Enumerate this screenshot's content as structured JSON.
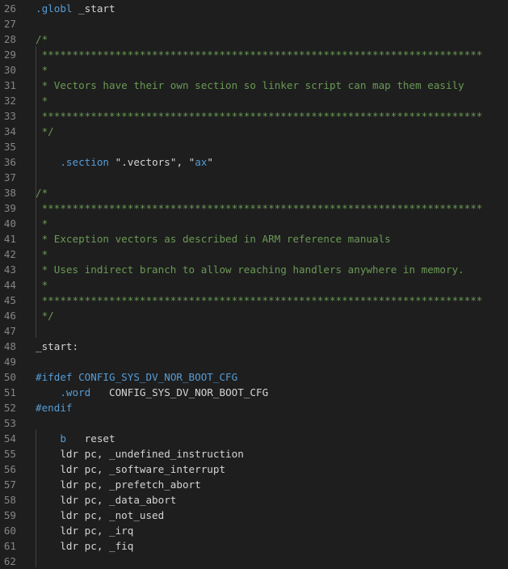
{
  "editor": {
    "lines": [
      {
        "n": "26",
        "tokens": [
          {
            "t": ".globl",
            "c": "kw"
          },
          {
            "t": " _start",
            "c": "plain"
          }
        ]
      },
      {
        "n": "27",
        "tokens": []
      },
      {
        "n": "28",
        "tokens": [
          {
            "t": "/*",
            "c": "cmt"
          }
        ]
      },
      {
        "n": "29",
        "tokens": [
          {
            "t": " ************************************************************************",
            "c": "cmt"
          }
        ]
      },
      {
        "n": "30",
        "tokens": [
          {
            "t": " *",
            "c": "cmt"
          }
        ]
      },
      {
        "n": "31",
        "tokens": [
          {
            "t": " * Vectors have their own section so linker script can map them easily",
            "c": "cmt"
          }
        ]
      },
      {
        "n": "32",
        "tokens": [
          {
            "t": " *",
            "c": "cmt"
          }
        ]
      },
      {
        "n": "33",
        "tokens": [
          {
            "t": " ************************************************************************",
            "c": "cmt"
          }
        ]
      },
      {
        "n": "34",
        "tokens": [
          {
            "t": " */",
            "c": "cmt"
          }
        ]
      },
      {
        "n": "35",
        "tokens": []
      },
      {
        "n": "36",
        "tokens": [
          {
            "t": "    ",
            "c": "plain"
          },
          {
            "t": ".section",
            "c": "kw"
          },
          {
            "t": " \"",
            "c": "plain"
          },
          {
            "t": ".vectors",
            "c": "plain"
          },
          {
            "t": "\", \"",
            "c": "plain"
          },
          {
            "t": "ax",
            "c": "kw"
          },
          {
            "t": "\"",
            "c": "plain"
          }
        ]
      },
      {
        "n": "37",
        "tokens": []
      },
      {
        "n": "38",
        "tokens": [
          {
            "t": "/*",
            "c": "cmt"
          }
        ]
      },
      {
        "n": "39",
        "tokens": [
          {
            "t": " ************************************************************************",
            "c": "cmt"
          }
        ]
      },
      {
        "n": "40",
        "tokens": [
          {
            "t": " *",
            "c": "cmt"
          }
        ]
      },
      {
        "n": "41",
        "tokens": [
          {
            "t": " * Exception vectors as described in ARM reference manuals",
            "c": "cmt"
          }
        ]
      },
      {
        "n": "42",
        "tokens": [
          {
            "t": " *",
            "c": "cmt"
          }
        ]
      },
      {
        "n": "43",
        "tokens": [
          {
            "t": " * Uses indirect branch to allow reaching handlers anywhere in memory.",
            "c": "cmt"
          }
        ]
      },
      {
        "n": "44",
        "tokens": [
          {
            "t": " *",
            "c": "cmt"
          }
        ]
      },
      {
        "n": "45",
        "tokens": [
          {
            "t": " ************************************************************************",
            "c": "cmt"
          }
        ]
      },
      {
        "n": "46",
        "tokens": [
          {
            "t": " */",
            "c": "cmt"
          }
        ]
      },
      {
        "n": "47",
        "tokens": []
      },
      {
        "n": "48",
        "tokens": [
          {
            "t": "_start:",
            "c": "plain"
          }
        ]
      },
      {
        "n": "49",
        "tokens": []
      },
      {
        "n": "50",
        "tokens": [
          {
            "t": "#ifdef",
            "c": "kw"
          },
          {
            "t": " CONFIG_SYS_DV_NOR_BOOT_CFG",
            "c": "kw"
          }
        ]
      },
      {
        "n": "51",
        "tokens": [
          {
            "t": "    ",
            "c": "plain"
          },
          {
            "t": ".word",
            "c": "kw"
          },
          {
            "t": "   CONFIG_SYS_DV_NOR_BOOT_CFG",
            "c": "plain"
          }
        ]
      },
      {
        "n": "52",
        "tokens": [
          {
            "t": "#endif",
            "c": "kw"
          }
        ]
      },
      {
        "n": "53",
        "tokens": []
      },
      {
        "n": "54",
        "tokens": [
          {
            "t": "    ",
            "c": "plain"
          },
          {
            "t": "b",
            "c": "kw"
          },
          {
            "t": "   reset",
            "c": "plain"
          }
        ]
      },
      {
        "n": "55",
        "tokens": [
          {
            "t": "    ldr pc, _undefined_instruction",
            "c": "plain"
          }
        ]
      },
      {
        "n": "56",
        "tokens": [
          {
            "t": "    ldr pc, _software_interrupt",
            "c": "plain"
          }
        ]
      },
      {
        "n": "57",
        "tokens": [
          {
            "t": "    ldr pc, _prefetch_abort",
            "c": "plain"
          }
        ]
      },
      {
        "n": "58",
        "tokens": [
          {
            "t": "    ldr pc, _data_abort",
            "c": "plain"
          }
        ]
      },
      {
        "n": "59",
        "tokens": [
          {
            "t": "    ldr pc, _not_used",
            "c": "plain"
          }
        ]
      },
      {
        "n": "60",
        "tokens": [
          {
            "t": "    ldr pc, _irq",
            "c": "plain"
          }
        ]
      },
      {
        "n": "61",
        "tokens": [
          {
            "t": "    ldr pc, _fiq",
            "c": "plain"
          }
        ]
      },
      {
        "n": "62",
        "tokens": []
      }
    ]
  }
}
